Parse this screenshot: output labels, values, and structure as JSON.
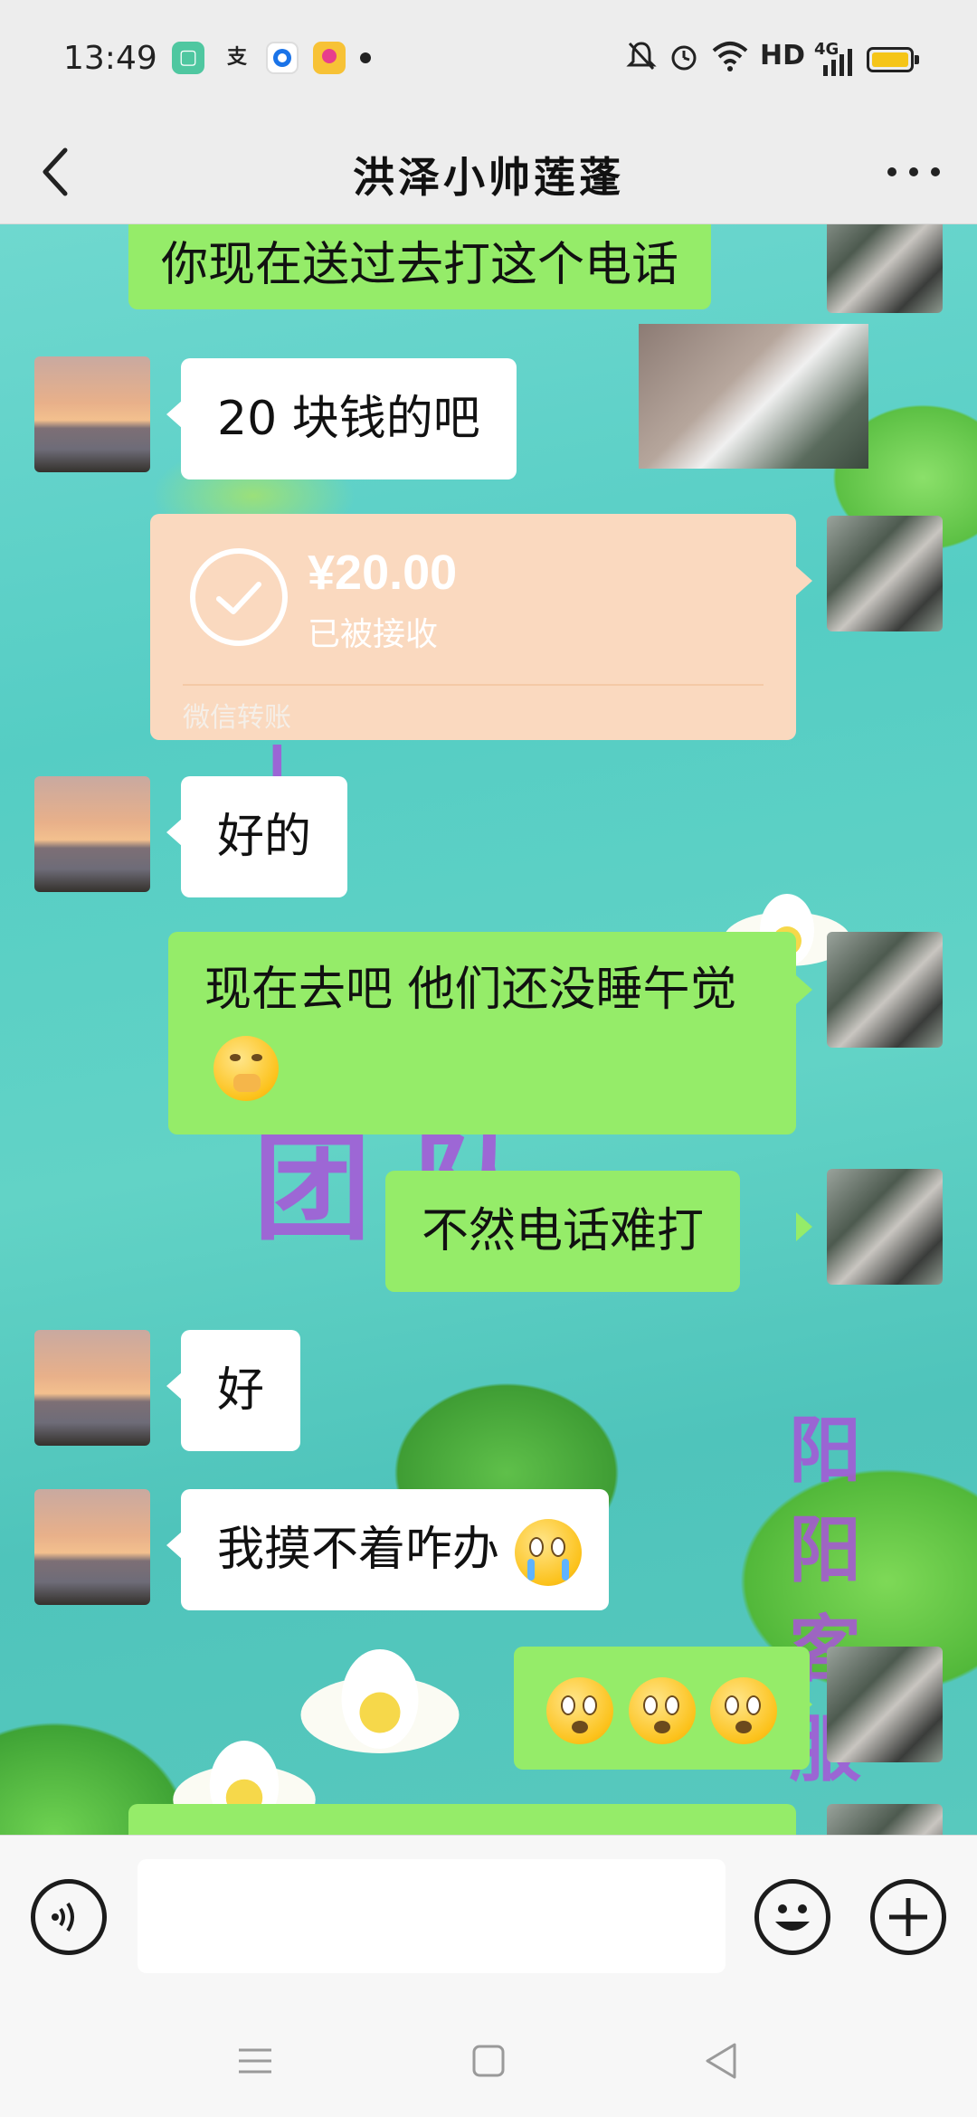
{
  "status_bar": {
    "time": "13:49",
    "apps": [
      "message-app-icon",
      "alipay-icon",
      "browser-icon",
      "flower-app-icon"
    ],
    "indicators": [
      "mute-icon",
      "alarm-icon",
      "wifi-icon"
    ],
    "network_hd": "HD",
    "network_gen": "4G",
    "battery_color": "#f5c518"
  },
  "header": {
    "title": "洪泽小帅莲蓬",
    "back_icon": "back-arrow-icon",
    "more_icon": "more-dots-icon"
  },
  "background": {
    "deco_left": "团\n队",
    "deco_right": "阳\n阳\n客\n服"
  },
  "messages": [
    {
      "side": "right",
      "text": "你现在送过去打这个电话"
    },
    {
      "side": "left",
      "text": "20 块钱的吧"
    },
    {
      "side": "right",
      "type": "transfer",
      "amount": "¥20.00",
      "status": "已被接收",
      "label": "微信转账"
    },
    {
      "side": "left",
      "text": "好的"
    },
    {
      "side": "right",
      "text": "现在去吧 他们还没睡午觉"
    },
    {
      "side": "right",
      "text": "不然电话难打"
    },
    {
      "side": "left",
      "text": "好"
    },
    {
      "side": "left",
      "text": "我摸不着咋办"
    },
    {
      "side": "right",
      "type": "emoji",
      "emoji": [
        "flushed-face-icon",
        "flushed-face-icon",
        "flushed-face-icon"
      ]
    }
  ],
  "colors": {
    "my_bubble": "#95ec69",
    "their_bubble": "#ffffff",
    "transfer_card": "#fad9bf"
  },
  "input_bar": {
    "voice_icon": "voice-icon",
    "emoji_icon": "emoji-icon",
    "plus_icon": "plus-icon",
    "placeholder": ""
  },
  "nav_bar": {
    "icons": [
      "menu-icon",
      "home-icon",
      "back-triangle-icon"
    ]
  }
}
